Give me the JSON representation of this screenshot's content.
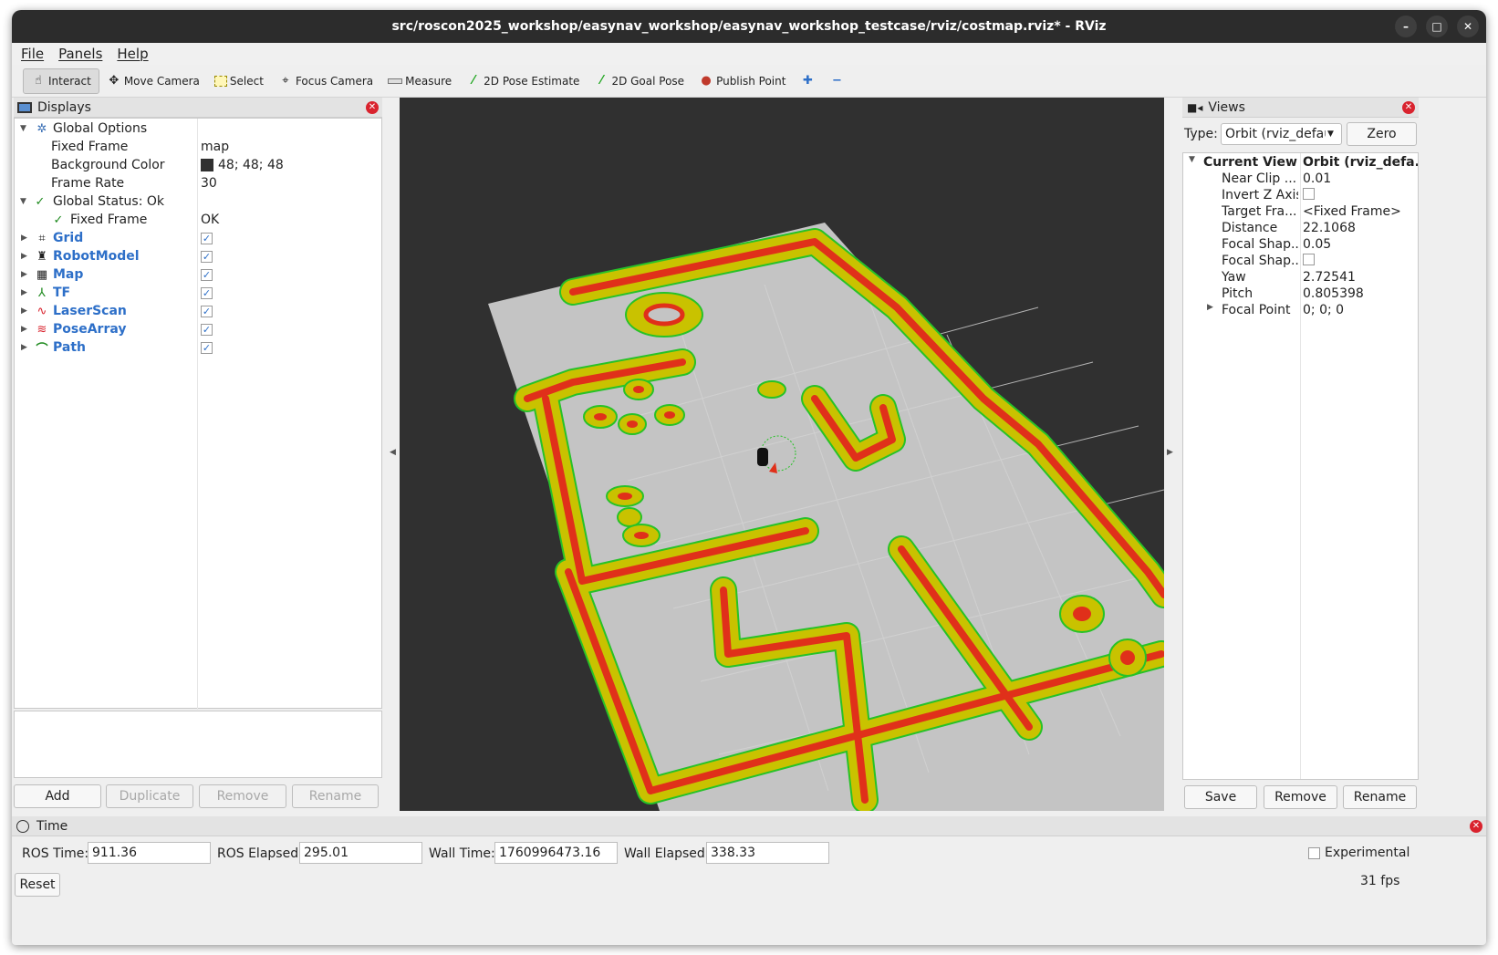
{
  "window": {
    "title": "src/roscon2025_workshop/easynav_workshop/easynav_workshop_testcase/rviz/costmap.rviz* - RViz",
    "controls": {
      "minimize": "–",
      "maximize": "□",
      "close": "✕"
    }
  },
  "menu": [
    "File",
    "Panels",
    "Help"
  ],
  "toolbar": {
    "tools": [
      {
        "label": "Interact",
        "icon": "pointer-hand-icon"
      },
      {
        "label": "Move Camera",
        "icon": "move-camera-icon"
      },
      {
        "label": "Select",
        "icon": "select-box-icon"
      },
      {
        "label": "Focus Camera",
        "icon": "focus-target-icon"
      },
      {
        "label": "Measure",
        "icon": "ruler-icon"
      },
      {
        "label": "2D Pose Estimate",
        "icon": "green-arrow-icon"
      },
      {
        "label": "2D Goal Pose",
        "icon": "green-arrow-icon"
      },
      {
        "label": "Publish Point",
        "icon": "map-pin-icon"
      }
    ],
    "add_symbol": "✚",
    "remove_symbol": "−"
  },
  "displays": {
    "title": "Displays",
    "global_options": {
      "label": "Global Options",
      "fixed_frame": {
        "label": "Fixed Frame",
        "value": "map"
      },
      "background_color": {
        "label": "Background Color",
        "value": "48; 48; 48",
        "color": "#303030"
      },
      "frame_rate": {
        "label": "Frame Rate",
        "value": "30"
      }
    },
    "global_status": {
      "label": "Global Status: Ok",
      "fixed_frame": {
        "label": "Fixed Frame",
        "value": "OK"
      }
    },
    "items": [
      {
        "label": "Grid",
        "icon": "grid-icon"
      },
      {
        "label": "RobotModel",
        "icon": "robot-icon"
      },
      {
        "label": "Map",
        "icon": "map-icon"
      },
      {
        "label": "TF",
        "icon": "axes-icon"
      },
      {
        "label": "LaserScan",
        "icon": "laser-icon"
      },
      {
        "label": "PoseArray",
        "icon": "pose-array-icon"
      },
      {
        "label": "Path",
        "icon": "path-icon"
      }
    ],
    "buttons": {
      "add": "Add",
      "duplicate": "Duplicate",
      "remove": "Remove",
      "rename": "Rename"
    }
  },
  "views": {
    "title": "Views",
    "type_label": "Type:",
    "type_value": "Orbit (rviz_defau",
    "zero_button": "Zero",
    "current_view": {
      "label": "Current View",
      "value": "Orbit (rviz_defa..."
    },
    "props": [
      {
        "label": "Near Clip ...",
        "value": "0.01"
      },
      {
        "label": "Invert Z Axis",
        "value": ""
      },
      {
        "label": "Target Fra...",
        "value": "<Fixed Frame>"
      },
      {
        "label": "Distance",
        "value": "22.1068"
      },
      {
        "label": "Focal Shap...",
        "value": "0.05"
      },
      {
        "label": "Focal Shap...",
        "value": ""
      },
      {
        "label": "Yaw",
        "value": "2.72541"
      },
      {
        "label": "Pitch",
        "value": "0.805398"
      },
      {
        "label": "Focal Point",
        "value": "0; 0; 0"
      }
    ],
    "buttons": {
      "save": "Save",
      "remove": "Remove",
      "rename": "Rename"
    }
  },
  "time": {
    "title": "Time",
    "ros_time_label": "ROS Time:",
    "ros_time": "911.36",
    "ros_elapsed_label": "ROS Elapsed:",
    "ros_elapsed": "295.01",
    "wall_time_label": "Wall Time:",
    "wall_time": "1760996473.16",
    "wall_elapsed_label": "Wall Elapsed:",
    "wall_elapsed": "338.33",
    "experimental_label": "Experimental",
    "reset_button": "Reset",
    "fps": "31 fps"
  },
  "colors": {
    "viewport_bg": "#303030",
    "map_floor": "#c4c4c4",
    "cost_yellow": "#c9c200",
    "cost_red": "#e0301a",
    "inflation_green": "#27c227",
    "accent_blue": "#2d6fc8"
  }
}
